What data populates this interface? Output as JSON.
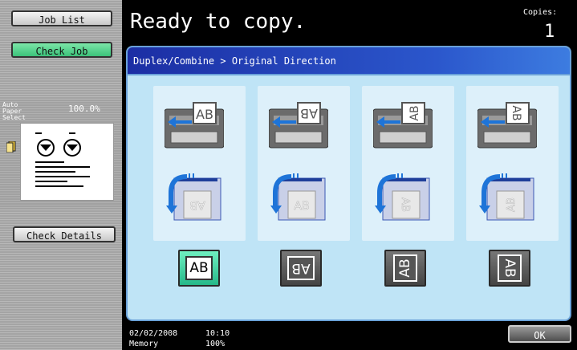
{
  "left_panel": {
    "job_list_label": "Job List",
    "check_job_label": "Check Job",
    "paper_label": "Auto Paper Select",
    "zoom_label": "100.0%",
    "check_details_label": "Check Details"
  },
  "header": {
    "status": "Ready to copy.",
    "copies_label": "Copies:",
    "copies_value": "1"
  },
  "panel": {
    "breadcrumb": "Duplex/Combine > Original Direction",
    "options": [
      {
        "name": "direction-top",
        "glyph": "AB",
        "selected": true
      },
      {
        "name": "direction-bottom",
        "glyph": "AB",
        "selected": false
      },
      {
        "name": "direction-left",
        "glyph": "AB",
        "selected": false
      },
      {
        "name": "direction-right",
        "glyph": "AB",
        "selected": false
      }
    ]
  },
  "footer": {
    "date": "02/02/2008",
    "time": "10:10",
    "memory_label": "Memory",
    "memory_value": "100%",
    "ok_label": "OK"
  },
  "colors": {
    "header_bg": "#000000",
    "panel_bg": "#bfe4f6",
    "panel_head": "#2b57cc",
    "selected_green": "#25b889",
    "arrow_blue": "#1e74d8"
  }
}
